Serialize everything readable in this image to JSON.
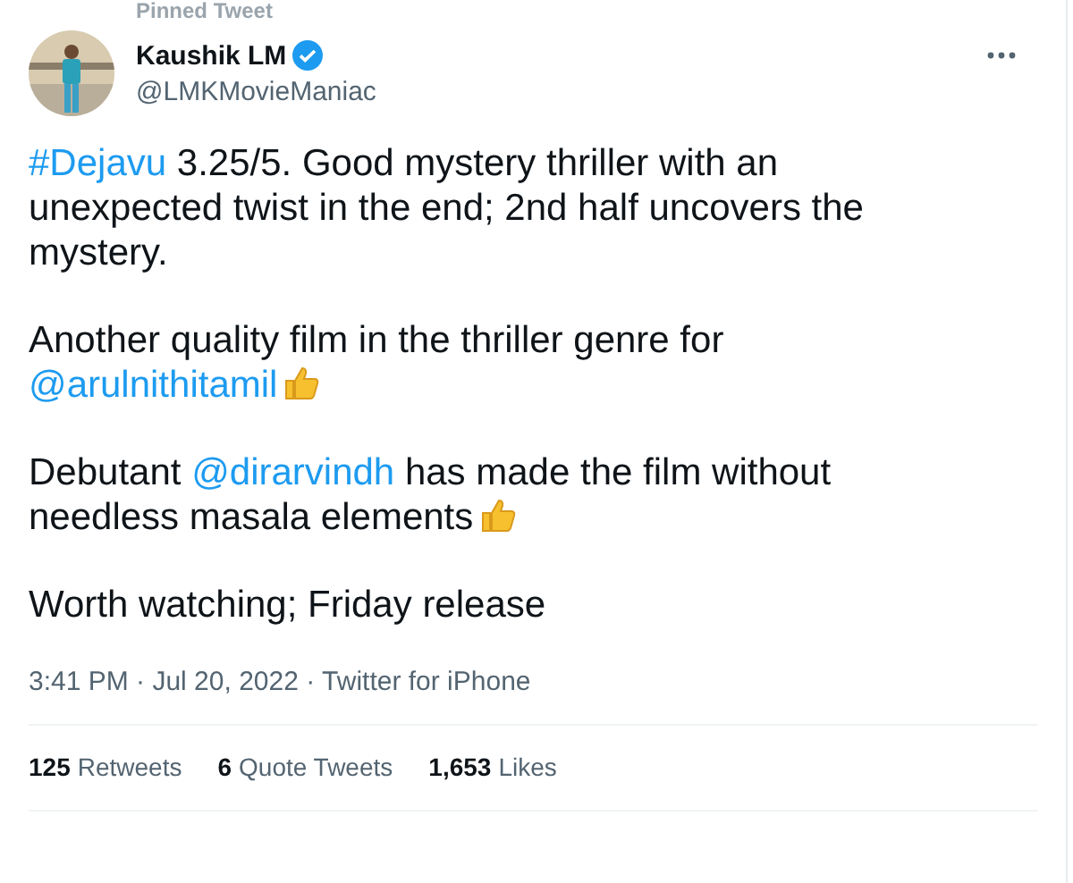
{
  "pinned": {
    "label": "Pinned Tweet"
  },
  "author": {
    "name": "Kaushik LM",
    "handle": "@LMKMovieManiac",
    "verified": true
  },
  "paragraphs": [
    [
      {
        "kind": "link",
        "text": "#Dejavu"
      },
      {
        "kind": "text",
        "text": " 3.25/5. Good mystery thriller with an unexpected twist in the end; 2nd half uncovers the mystery."
      }
    ],
    [
      {
        "kind": "text",
        "text": "Another quality film in the thriller genre for "
      },
      {
        "kind": "link",
        "text": "@arulnithitamil"
      },
      {
        "kind": "emoji"
      }
    ],
    [
      {
        "kind": "text",
        "text": "Debutant "
      },
      {
        "kind": "link",
        "text": "@dirarvindh"
      },
      {
        "kind": "text",
        "text": " has made the film without needless masala elements"
      },
      {
        "kind": "emoji"
      }
    ],
    [
      {
        "kind": "text",
        "text": "Worth watching; Friday release"
      }
    ]
  ],
  "meta": {
    "time": "3:41 PM",
    "separator": "·",
    "date": "Jul 20, 2022",
    "separator_2": "·",
    "source": "Twitter for iPhone"
  },
  "stats": [
    {
      "count": "125",
      "label": "Retweets"
    },
    {
      "count": "6",
      "label": "Quote Tweets"
    },
    {
      "count": "1,653",
      "label": "Likes"
    }
  ]
}
